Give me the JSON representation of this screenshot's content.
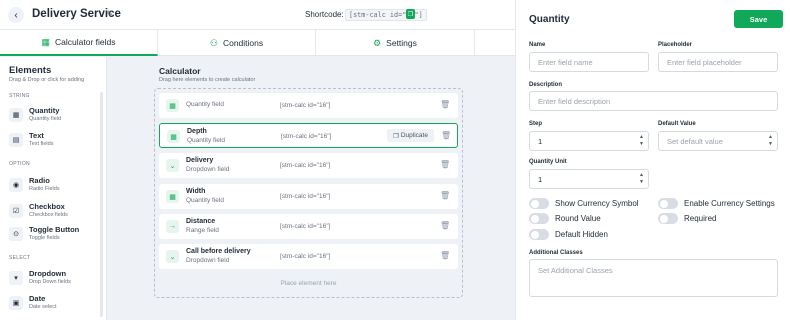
{
  "header": {
    "title": "Delivery Service",
    "shortcode_label": "Shortcode:",
    "shortcode_value": "[stm-calc id=\"16\"]"
  },
  "tabs": [
    {
      "label": "Calculator fields",
      "icon": "calculator-icon",
      "active": true
    },
    {
      "label": "Conditions",
      "icon": "conditions-icon",
      "active": false
    },
    {
      "label": "Settings",
      "icon": "gear-icon",
      "active": false
    }
  ],
  "sidebar": {
    "title": "Elements",
    "subtitle": "Drag & Drop or click for adding",
    "groups": [
      "STRING",
      "OPTION",
      "SELECT"
    ],
    "items": [
      {
        "name": "Quantity",
        "desc": "Quantity field",
        "icon": "quantity-icon"
      },
      {
        "name": "Text",
        "desc": "Text fields",
        "icon": "text-icon"
      },
      {
        "name": "Radio",
        "desc": "Radio Fields",
        "icon": "radio-icon"
      },
      {
        "name": "Checkbox",
        "desc": "Checkbox fields",
        "icon": "checkbox-icon"
      },
      {
        "name": "Toggle Button",
        "desc": "Toggle fields",
        "icon": "toggle-icon"
      },
      {
        "name": "Dropdown",
        "desc": "Drop Down fields",
        "icon": "dropdown-icon"
      },
      {
        "name": "Date",
        "desc": "Date select",
        "icon": "calendar-icon"
      }
    ]
  },
  "calculator": {
    "title": "Calculator",
    "subtitle": "Drag here elements to create calculator",
    "placeholder": "Place element here",
    "duplicate_label": "Duplicate",
    "fields": [
      {
        "name": "",
        "type": "Quantity field",
        "code": "[stm-calc id=\"16\"]",
        "icon": "quantity-icon"
      },
      {
        "name": "Depth",
        "type": "Quantity field",
        "code": "[stm-calc id=\"16\"]",
        "icon": "quantity-icon"
      },
      {
        "name": "Delivery",
        "type": "Dropdown field",
        "code": "[stm-calc id=\"16\"]",
        "icon": "chevron-down-icon"
      },
      {
        "name": "Width",
        "type": "Quantity field",
        "code": "[stm-calc id=\"16\"]",
        "icon": "quantity-icon"
      },
      {
        "name": "Distance",
        "type": "Range field",
        "code": "[stm-calc id=\"16\"]",
        "icon": "arrow-right-icon"
      },
      {
        "name": "Call before delivery",
        "type": "Dropdown field",
        "code": "[stm-calc id=\"16\"]",
        "icon": "chevron-down-icon"
      }
    ]
  },
  "panel": {
    "title": "Quantity",
    "save_label": "Save",
    "name_label": "Name",
    "name_placeholder": "Enter field name",
    "placeholder_label": "Placeholder",
    "placeholder_placeholder": "Enter field placeholder",
    "description_label": "Description",
    "description_placeholder": "Enter field description",
    "step_label": "Step",
    "step_value": "1",
    "default_label": "Default Value",
    "default_placeholder": "Set default value",
    "unit_label": "Quantity Unit",
    "unit_value": "1",
    "toggles": [
      {
        "label": "Show Currency Symbol",
        "on": false
      },
      {
        "label": "Enable Currency Settings",
        "on": false
      },
      {
        "label": "Round Value",
        "on": false
      },
      {
        "label": "Required",
        "on": false
      },
      {
        "label": "Default Hidden",
        "on": false
      }
    ],
    "classes_label": "Additional Classes",
    "classes_placeholder": "Set Additional Classes"
  },
  "colors": {
    "accent": "#11a85a"
  }
}
